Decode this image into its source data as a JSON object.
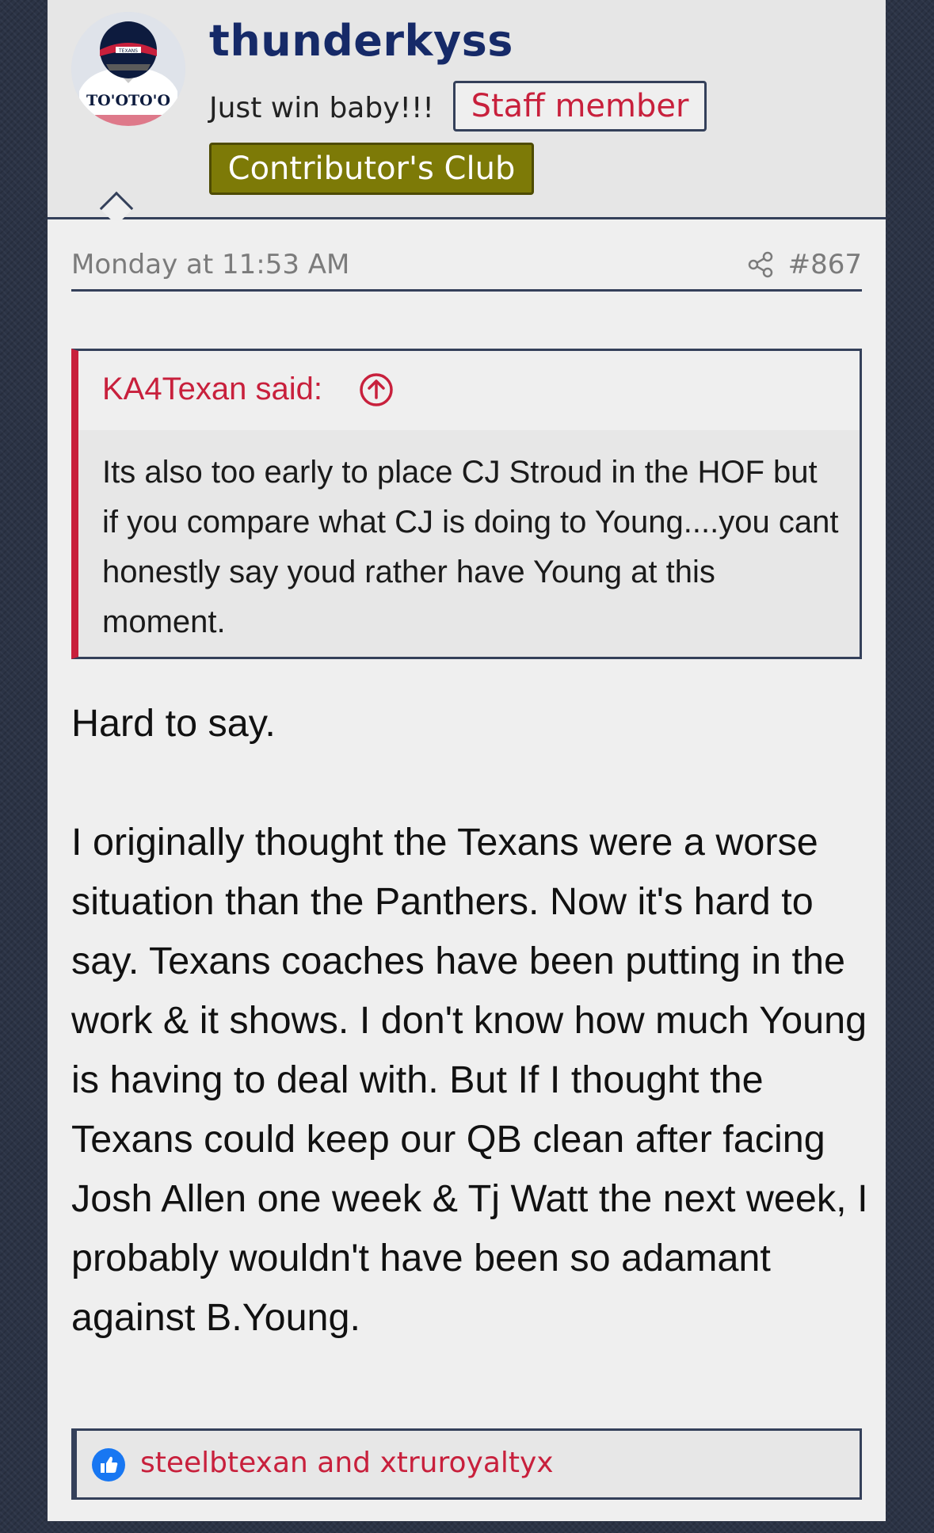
{
  "author": {
    "username": "thunderkyss",
    "user_title": "Just win baby!!!",
    "badges": {
      "staff": "Staff member",
      "club": "Contributor's Club"
    },
    "avatar": {
      "helmet_text": "TEXANS",
      "jersey_text": "TO'OTO'O"
    }
  },
  "meta": {
    "date": "Monday at 11:53 AM",
    "share_icon": "share-icon",
    "post_number": "#867"
  },
  "quote": {
    "author_line": "KA4Texan said:",
    "body": "Its also too early to place CJ Stroud in the HOF but if you compare what CJ is doing to Young....you cant honestly say youd rather have Young at this moment."
  },
  "post": {
    "paragraph_1": "Hard to say.",
    "paragraph_2": "I originally thought the Texans were a worse situation than the Panthers. Now it's hard to say. Texans coaches have been putting in the work & it shows. I don't know how much Young is having to deal with. But If I thought the Texans could keep our QB clean after facing Josh Allen one week & Tj Watt the next week, I probably wouldn't have been so adamant against B.Young."
  },
  "reactions": {
    "icon": "like-icon",
    "text": "steelbtexan and xtruroyaltyx"
  },
  "colors": {
    "accent_red": "#c8203c",
    "navy": "#162a68",
    "border": "#34405a",
    "club_badge": "#7d7a07"
  }
}
